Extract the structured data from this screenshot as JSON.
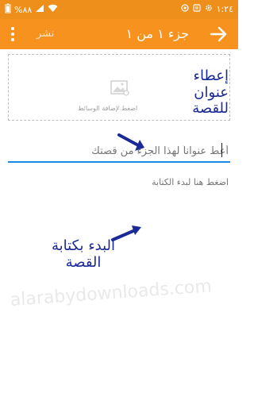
{
  "status_bar": {
    "time": "١:٢٤",
    "battery": "%٨٨",
    "icons": [
      "battery-icon",
      "signal-icon",
      "wifi-icon",
      "data-saver-icon",
      "notification-icon",
      "settings-icon"
    ]
  },
  "app_bar": {
    "title": "جزء ١ من ١",
    "publish_label": "نشر",
    "icons": [
      "menu-dots-icon",
      "back-arrow-icon"
    ]
  },
  "media": {
    "label": "اضغط لإضافة الوسائط",
    "icon": "image-icon"
  },
  "annotations": {
    "title_hint": "إعطاء عنوان للقصة",
    "writing_hint": "البدء بكتابة القصة"
  },
  "editor": {
    "title_placeholder": "أعط عنواناً لهذا الجزء من قصتك",
    "body_placeholder": "اضغط هنا لبدء الكتابة"
  },
  "watermark": "alarabydownloads.com",
  "colors": {
    "app_bar": "#f7921e",
    "status_bar": "#ef8f1b",
    "accent": "#1e88e5",
    "annotation": "#1b2a94"
  }
}
